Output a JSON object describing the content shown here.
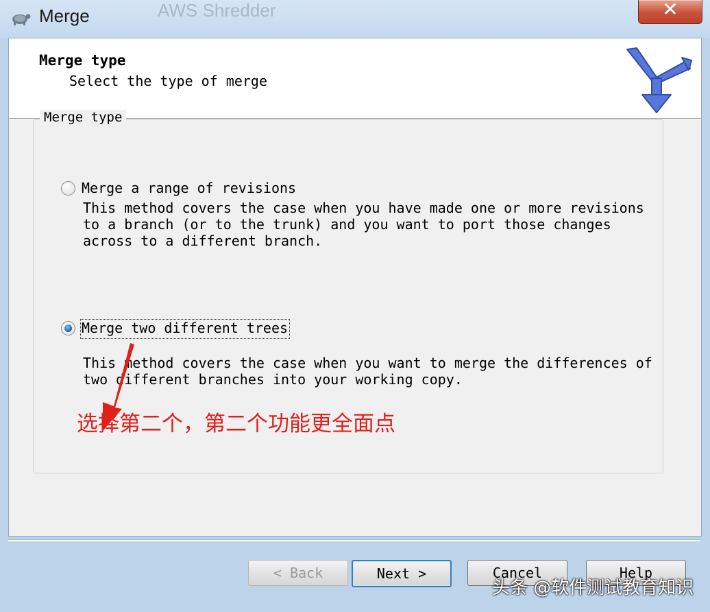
{
  "window": {
    "title": "Merge",
    "background_title": "AWS Shredder"
  },
  "header": {
    "title": "Merge type",
    "subtitle": "Select the type of merge"
  },
  "group": {
    "label": "Merge type"
  },
  "options": [
    {
      "label": "Merge a range of revisions",
      "checked": false,
      "description": "This method covers the case when you have made one or more revisions\nto a branch (or to the trunk) and you want to port those changes\nacross to a different branch."
    },
    {
      "label": "Merge two different trees",
      "checked": true,
      "description": "This method covers the case when you want to merge the differences of\ntwo different branches into your working copy."
    }
  ],
  "annotation": {
    "text": "选择第二个，第二个功能更全面点",
    "color": "#e0201b"
  },
  "buttons": {
    "back": "< Back",
    "next": "Next >",
    "cancel": "Cancel",
    "help": "Help"
  },
  "watermark": "头条 @软件测试教育知识",
  "colors": {
    "close_button": "#c8523b",
    "accent": "#3c7fb1",
    "logo": "#4a6fd6"
  },
  "icons": {
    "app": "tortoise-icon",
    "logo": "merge-arrow-icon",
    "close": "close-icon"
  }
}
